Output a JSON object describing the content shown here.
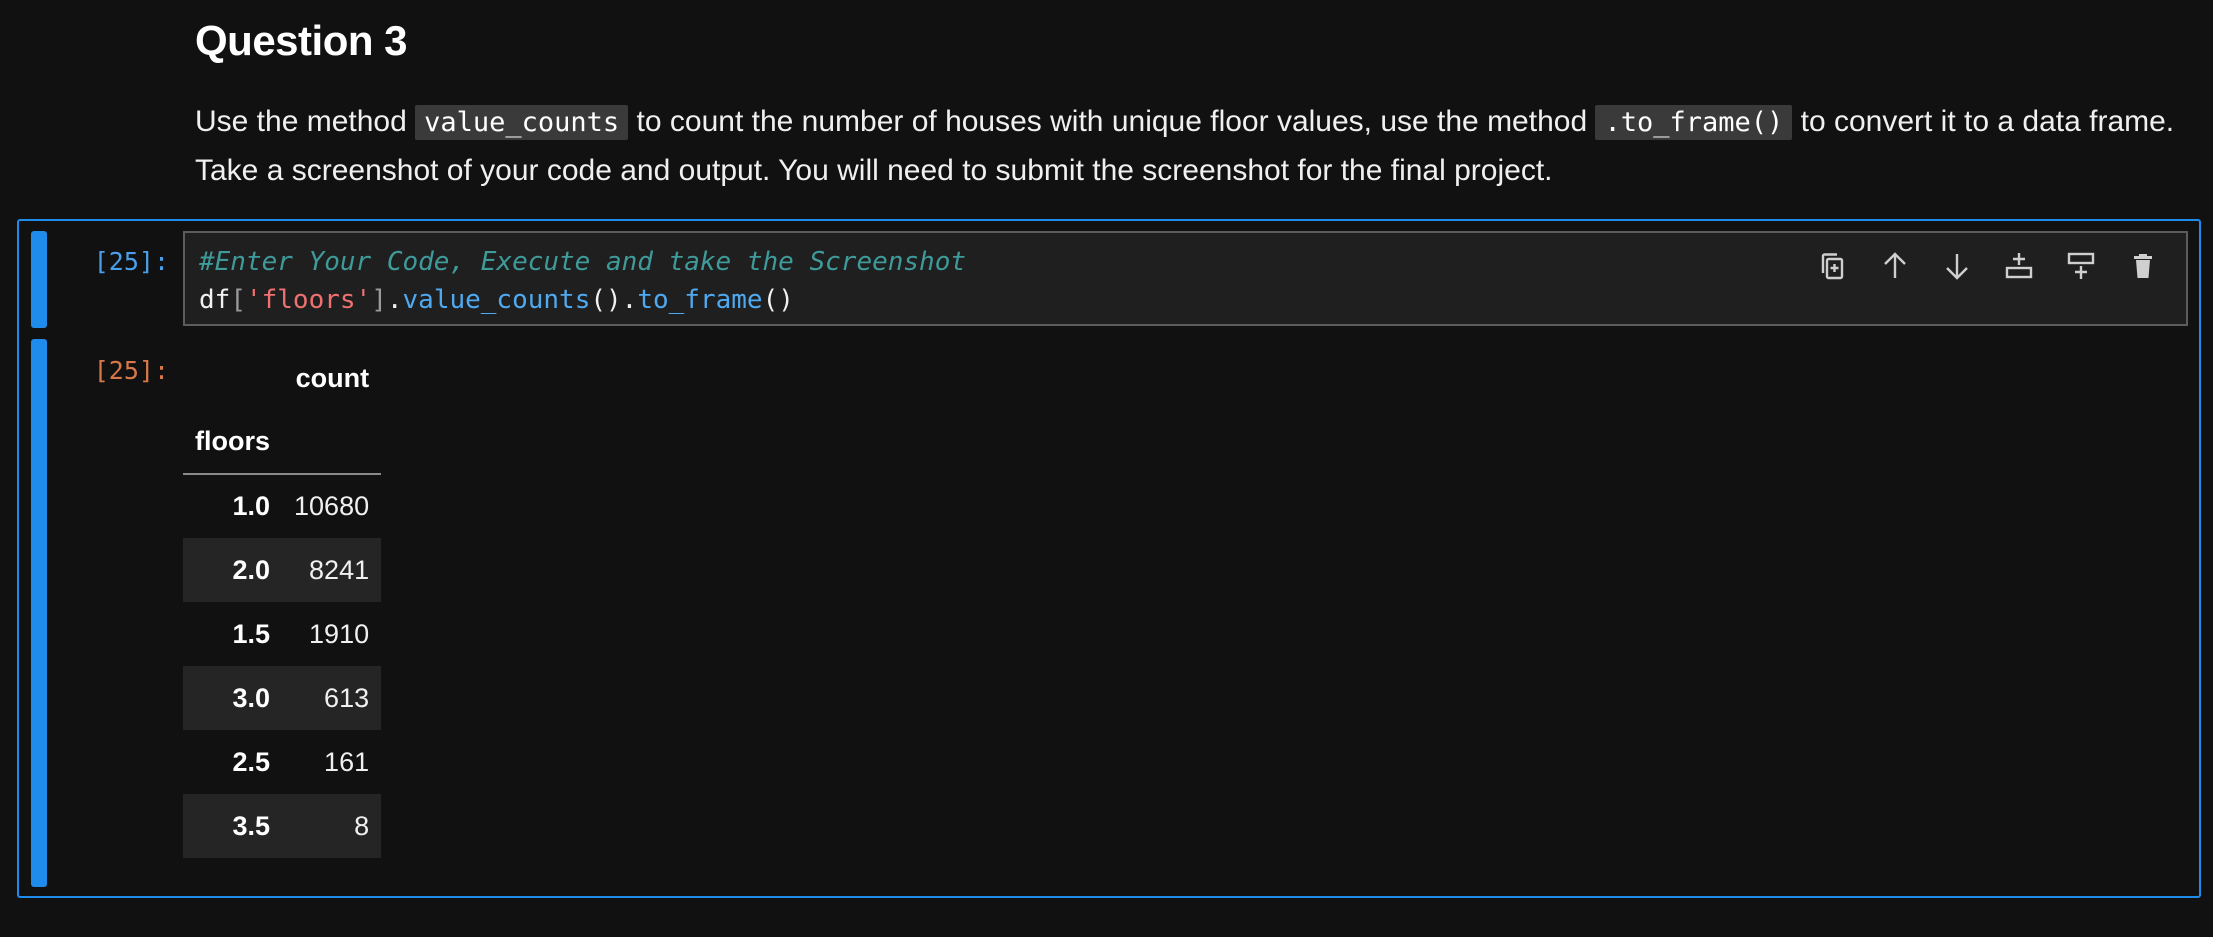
{
  "markdown": {
    "heading": "Question 3",
    "para_part1": "Use the method ",
    "code1": "value_counts",
    "para_part2": " to count the number of houses with unique floor values, use the method ",
    "code2": ".to_frame()",
    "para_part3": " to convert it to a data frame. Take a screenshot of your code and output. You will need to submit the screenshot for the final project."
  },
  "cell": {
    "input_prompt": "[25]:",
    "output_prompt": "[25]:",
    "code": {
      "comment": "#Enter Your Code, Execute and take the Screenshot",
      "line2": {
        "name": "df",
        "open_bracket": "[",
        "string": "'floors'",
        "close_bracket": "]",
        "dot1": ".",
        "func1": "value_counts",
        "parens1": "()",
        "dot2": ".",
        "func2": "to_frame",
        "parens2": "()"
      }
    },
    "toolbar": [
      {
        "icon": "duplicate-icon"
      },
      {
        "icon": "move-up-icon"
      },
      {
        "icon": "move-down-icon"
      },
      {
        "icon": "insert-above-icon"
      },
      {
        "icon": "insert-below-icon"
      },
      {
        "icon": "delete-icon"
      }
    ]
  },
  "output_table": {
    "column_header": "count",
    "index_name": "floors",
    "rows": [
      {
        "index": "1.0",
        "count": "10680"
      },
      {
        "index": "2.0",
        "count": "8241"
      },
      {
        "index": "1.5",
        "count": "1910"
      },
      {
        "index": "3.0",
        "count": "613"
      },
      {
        "index": "2.5",
        "count": "161"
      },
      {
        "index": "3.5",
        "count": "8"
      }
    ]
  },
  "colors": {
    "accent": "#1f8ceb",
    "background": "#111111",
    "output_prompt": "#d7774a",
    "input_prompt": "#4a9fe8"
  }
}
